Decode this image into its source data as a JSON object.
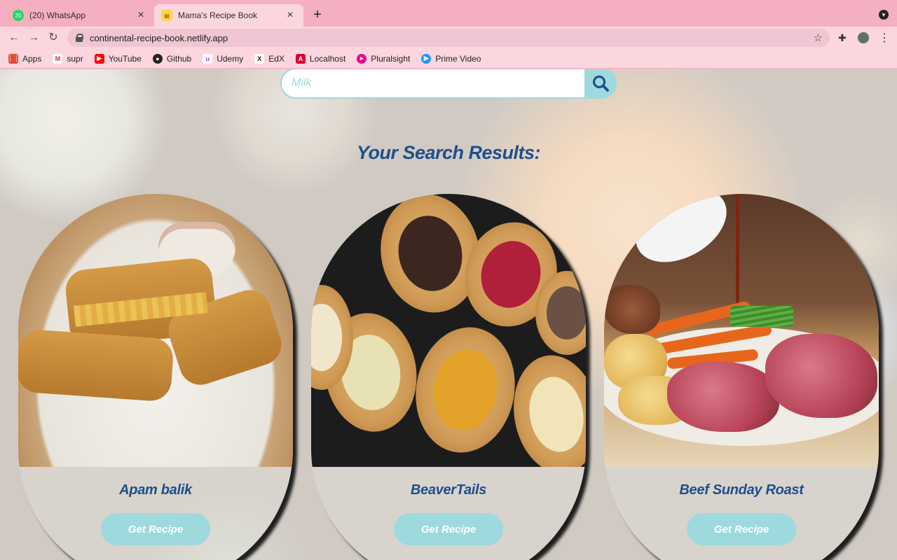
{
  "browser": {
    "tabs": [
      {
        "title": "(20) WhatsApp",
        "favicon": "whatsapp-icon",
        "active": false
      },
      {
        "title": "Mama's Recipe Book",
        "favicon": "recipe-book-icon",
        "active": true
      }
    ],
    "url": "continental-recipe-book.netlify.app",
    "bookmarks": [
      {
        "label": "Apps",
        "icon": "apps-grid-icon",
        "color": "#e34a3b"
      },
      {
        "label": "supr",
        "icon": "gmail-icon",
        "color": "#d93025"
      },
      {
        "label": "YouTube",
        "icon": "youtube-icon",
        "color": "#ff0000"
      },
      {
        "label": "Github",
        "icon": "github-icon",
        "color": "#222222"
      },
      {
        "label": "Udemy",
        "icon": "udemy-icon",
        "color": "#a435f0"
      },
      {
        "label": "EdX",
        "icon": "edx-icon",
        "color": "#111111"
      },
      {
        "label": "Localhost",
        "icon": "angular-icon",
        "color": "#dd0031"
      },
      {
        "label": "Pluralsight",
        "icon": "pluralsight-icon",
        "color": "#e80a89"
      },
      {
        "label": "Prime Video",
        "icon": "prime-video-icon",
        "color": "#1a98ff"
      }
    ]
  },
  "search": {
    "placeholder": "Milk"
  },
  "results": {
    "title": "Your Search Results:",
    "cards": [
      {
        "name": "Apam balik",
        "button": "Get Recipe"
      },
      {
        "name": "BeaverTails",
        "button": "Get Recipe"
      },
      {
        "name": "Beef Sunday Roast",
        "button": "Get Recipe"
      }
    ]
  },
  "colors": {
    "accent": "#9ed9de",
    "heading": "#1f4f8a",
    "chrome": "#f4afc0"
  }
}
